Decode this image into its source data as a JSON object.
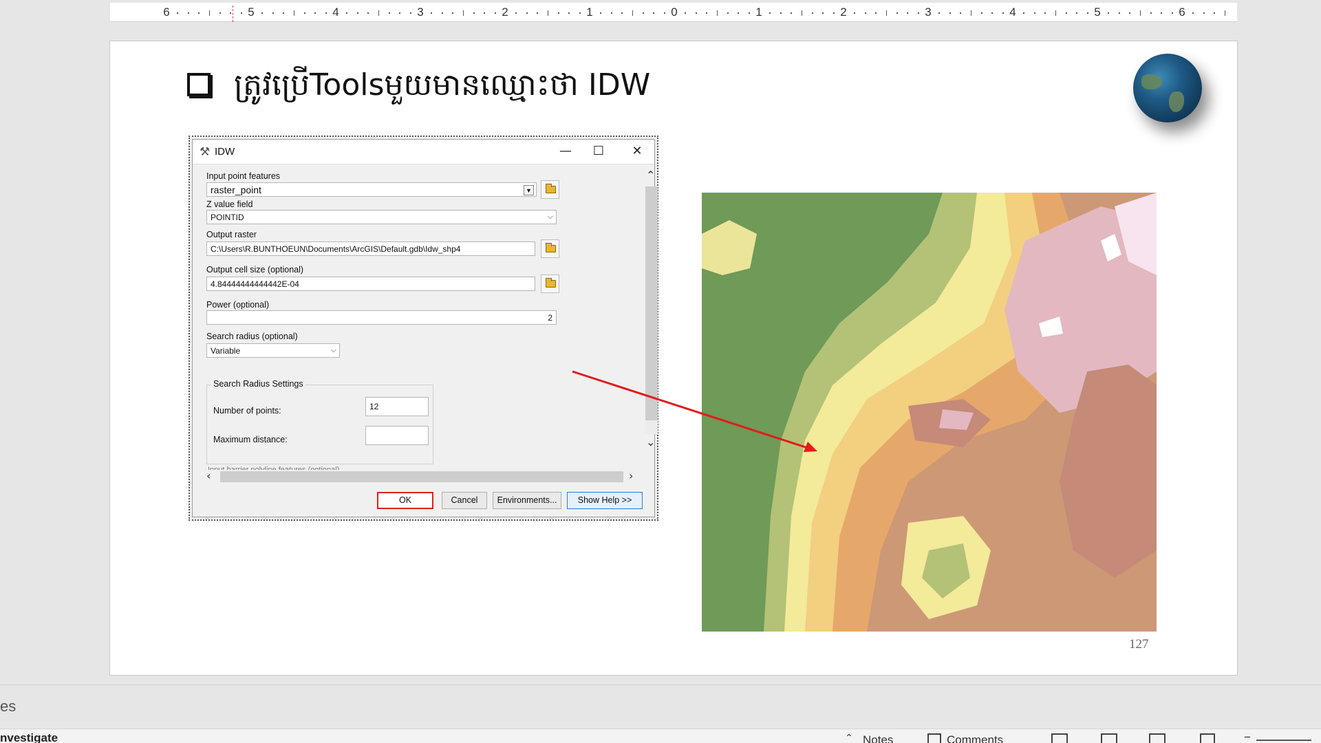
{
  "ruler": {
    "labels": [
      "6",
      "5",
      "4",
      "3",
      "2",
      "1",
      "0",
      "1",
      "2",
      "3",
      "4",
      "5",
      "6"
    ]
  },
  "slide": {
    "title": "ត្រូវប្រើToolsមួយមានឈ្មោះថា IDW",
    "page_number": "127"
  },
  "dialog": {
    "title": "IDW",
    "minimize": "—",
    "maximize": "☐",
    "close": "✕",
    "input_point_label": "Input point features",
    "input_point_value": "raster_point",
    "z_value_label": "Z value field",
    "z_value_value": "POINTID",
    "output_raster_label": "Output raster",
    "output_raster_value": "C:\\Users\\R.BUNTHOEUN\\Documents\\ArcGIS\\Default.gdb\\Idw_shp4",
    "cell_size_label": "Output cell size (optional)",
    "cell_size_value": "4.84444444444442E-04",
    "power_label": "Power (optional)",
    "power_value": "2",
    "search_radius_label": "Search radius (optional)",
    "search_radius_value": "Variable",
    "radius_group_title": "Search Radius Settings",
    "num_points_label": "Number of points:",
    "num_points_value": "12",
    "max_distance_label": "Maximum distance:",
    "max_distance_value": "",
    "ok": "OK",
    "cancel": "Cancel",
    "environments": "Environments...",
    "show_help": "Show Help >>"
  },
  "bottom": {
    "notes_partial": "es",
    "status_left": "nvestigate",
    "notes": "Notes",
    "comments": "Comments"
  },
  "colors": {
    "ok_highlight": "#e02020",
    "annotation_arrow": "#e31c1c"
  }
}
